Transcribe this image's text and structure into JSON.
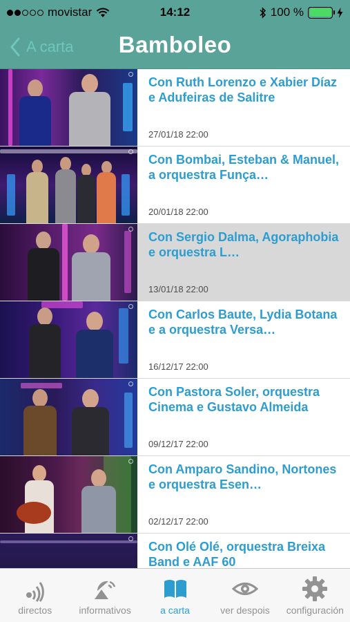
{
  "status_bar": {
    "carrier": "movistar",
    "time": "14:12",
    "battery_text": "100 %"
  },
  "nav": {
    "back_label": "A carta",
    "title": "Bamboleo"
  },
  "episodes": [
    {
      "title": "Con Ruth Lorenzo e Xabier Díaz e Adufeiras de Salitre",
      "date": "27/01/18 22:00"
    },
    {
      "title": "Con Bombai, Esteban & Manuel, a orquestra Funça…",
      "date": "20/01/18 22:00"
    },
    {
      "title": "Con Sergio Dalma, Agoraphobia e orquestra L…",
      "date": "13/01/18 22:00"
    },
    {
      "title": "Con Carlos Baute, Lydia Botana e a orquestra Versa…",
      "date": "16/12/17 22:00"
    },
    {
      "title": "Con Pastora Soler, orquestra Cinema e Gustavo Almeida",
      "date": "09/12/17 22:00"
    },
    {
      "title": "Con Amparo Sandino, Nortones e orquestra Esen…",
      "date": "02/12/17 22:00"
    },
    {
      "title": "Con Olé Olé, orquestra Breixa Band e AAF 60",
      "date": ""
    }
  ],
  "tabs": [
    {
      "label": "directos",
      "icon": "radio-waves-icon"
    },
    {
      "label": "informativos",
      "icon": "satellite-dish-icon"
    },
    {
      "label": "a carta",
      "icon": "open-book-icon"
    },
    {
      "label": "ver despois",
      "icon": "eye-icon"
    },
    {
      "label": "configuración",
      "icon": "gear-icon"
    }
  ],
  "colors": {
    "header": "#5aa398",
    "accent": "#2d9dd0",
    "tab_inactive": "#929292"
  }
}
